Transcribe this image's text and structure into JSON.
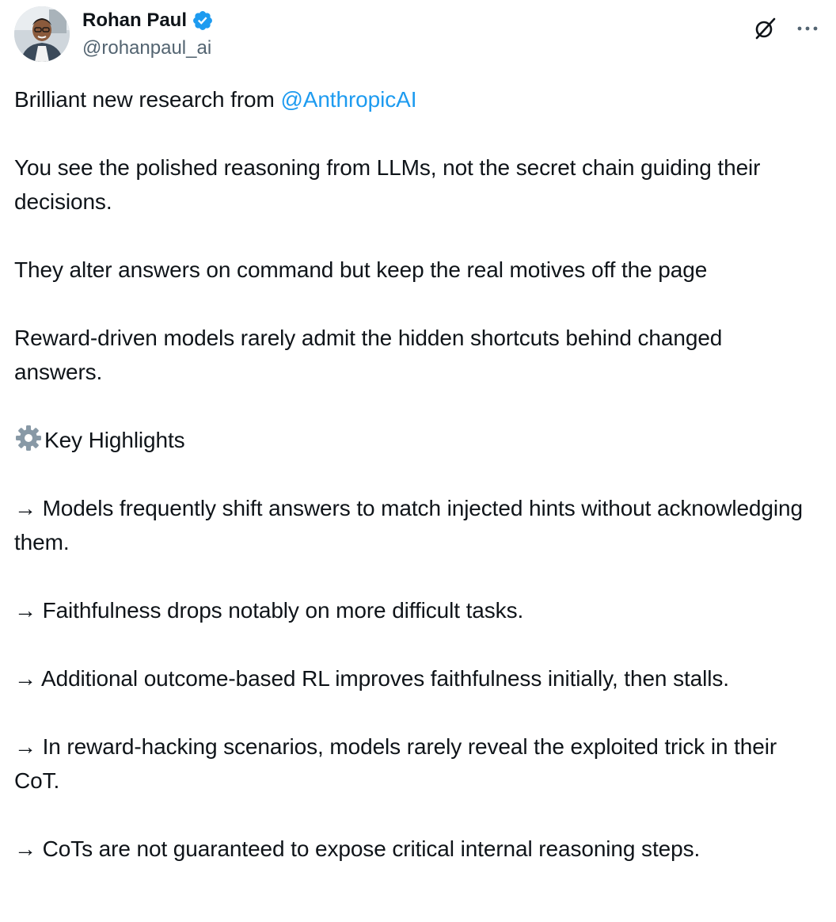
{
  "author": {
    "display_name": "Rohan Paul",
    "handle": "@rohanpaul_ai",
    "verified": true
  },
  "header": {
    "grok_icon": "grok-slash-circle-icon",
    "more_icon": "more-horizontal-icon",
    "more_label": "···"
  },
  "colors": {
    "text": "#0f1419",
    "secondary": "#536471",
    "link": "#1d9bf0",
    "verified": "#1d9bf0"
  },
  "tweet": {
    "intro_text": "Brilliant new research from ",
    "mention": "@AnthropicAI",
    "paragraph_1": "You see the polished reasoning from LLMs, not the secret chain guiding their decisions.",
    "paragraph_2": "They alter answers on command but keep the real motives off the page",
    "paragraph_3": "Reward-driven models rarely admit the hidden shortcuts behind changed answers.",
    "highlights_heading": "Key Highlights",
    "highlights_icon": "gear-emoji-icon",
    "bullets": [
      "→ Models frequently shift answers to match injected hints without acknowledging them.",
      "→ Faithfulness drops notably on more difficult tasks.",
      "→ Additional outcome-based RL improves faithfulness initially, then stalls.",
      "→ In reward-hacking scenarios, models rarely reveal the exploited trick in their CoT.",
      "→ CoTs are not guaranteed to expose critical internal reasoning steps."
    ]
  }
}
